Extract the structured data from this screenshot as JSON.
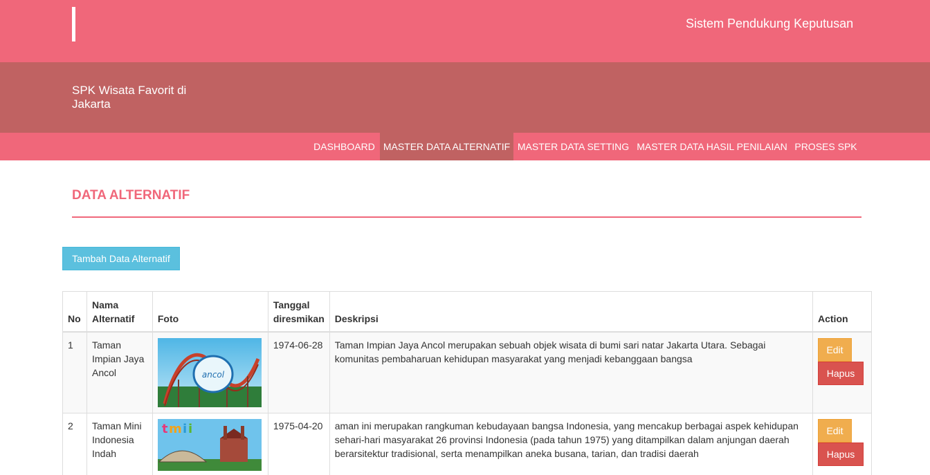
{
  "header": {
    "system_title": "Sistem Pendukung Keputusan",
    "brand": "SPK Wisata Favorit di Jakarta",
    "primary_color": "#f0677a",
    "secondary_color": "#c06262"
  },
  "nav": {
    "items": [
      {
        "label": "DASHBOARD",
        "active": false
      },
      {
        "label": "MASTER DATA ALTERNATIF",
        "active": true
      },
      {
        "label": "MASTER DATA SETTING",
        "active": false
      },
      {
        "label": "MASTER DATA HASIL PENILAIAN",
        "active": false
      },
      {
        "label": "PROSES SPK",
        "active": false
      }
    ]
  },
  "page": {
    "title": "DATA ALTERNATIF",
    "add_button": "Tambah Data Alternatif"
  },
  "table": {
    "headers": {
      "no": "No",
      "nama": "Nama Alternatif",
      "foto": "Foto",
      "tanggal": "Tanggal diresmikan",
      "deskripsi": "Deskripsi",
      "action": "Action"
    },
    "rows": [
      {
        "no": "1",
        "nama": "Taman Impian Jaya Ancol",
        "foto_icon": "ancol-photo",
        "tanggal": "1974-06-28",
        "deskripsi": "Taman Impian Jaya Ancol merupakan sebuah objek wisata di bumi sari natar Jakarta Utara. Sebagai komunitas pembaharuan kehidupan masyarakat yang menjadi kebanggaan bangsa",
        "edit": "Edit",
        "hapus": "Hapus"
      },
      {
        "no": "2",
        "nama": "Taman Mini Indonesia Indah",
        "foto_icon": "tmii-photo",
        "tanggal": "1975-04-20",
        "deskripsi": "aman ini merupakan rangkuman kebudayaan bangsa Indonesia, yang mencakup berbagai aspek kehidupan sehari-hari masyarakat 26 provinsi Indonesia (pada tahun 1975) yang ditampilkan dalam anjungan daerah berarsitektur tradisional, serta menampilkan aneka busana, tarian, dan tradisi daerah",
        "edit": "Edit",
        "hapus": "Hapus"
      }
    ]
  }
}
